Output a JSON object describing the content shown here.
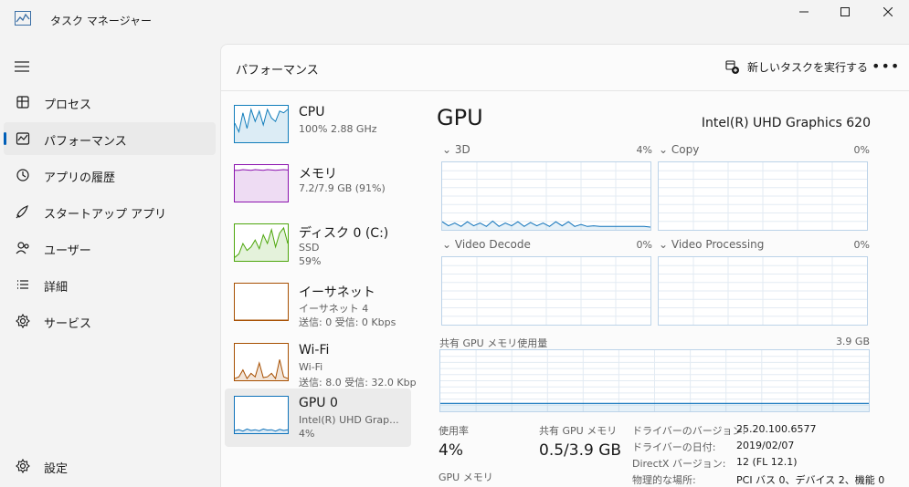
{
  "window": {
    "title": "タスク マネージャー"
  },
  "nav": {
    "items": [
      {
        "label": "プロセス",
        "icon": "processes-icon"
      },
      {
        "label": "パフォーマンス",
        "icon": "performance-icon"
      },
      {
        "label": "アプリの履歴",
        "icon": "history-icon"
      },
      {
        "label": "スタートアップ アプリ",
        "icon": "startup-icon"
      },
      {
        "label": "ユーザー",
        "icon": "users-icon"
      },
      {
        "label": "詳細",
        "icon": "details-icon"
      },
      {
        "label": "サービス",
        "icon": "services-icon"
      }
    ],
    "settings_label": "設定",
    "active_index": 1
  },
  "header": {
    "title": "パフォーマンス",
    "run_task_label": "新しいタスクを実行する",
    "more_label": "•••"
  },
  "devices": [
    {
      "name": "CPU",
      "sub1": "100%  2.88 GHz",
      "sub2": "",
      "color": "#117dbb"
    },
    {
      "name": "メモリ",
      "sub1": "7.2/7.9 GB (91%)",
      "sub2": "",
      "color": "#8b12ae"
    },
    {
      "name": "ディスク 0 (C:)",
      "sub1": "SSD",
      "sub2": "59%",
      "color": "#4da60c"
    },
    {
      "name": "イーサネット",
      "sub1": "イーサネット 4",
      "sub2": "送信: 0 受信: 0 Kbps",
      "color": "#a74f01"
    },
    {
      "name": "Wi-Fi",
      "sub1": "Wi-Fi",
      "sub2": "送信: 8.0 受信: 32.0 Kbp",
      "color": "#a74f01"
    },
    {
      "name": "GPU 0",
      "sub1": "Intel(R) UHD Grap...",
      "sub2": "4%",
      "color": "#0e72ba"
    }
  ],
  "gpu": {
    "title": "GPU",
    "model": "Intel(R) UHD Graphics 620",
    "engines": [
      {
        "label": "3D",
        "pct": "4%"
      },
      {
        "label": "Copy",
        "pct": "0%"
      },
      {
        "label": "Video Decode",
        "pct": "0%"
      },
      {
        "label": "Video Processing",
        "pct": "0%"
      }
    ],
    "shared_memory_label": "共有 GPU メモリ使用量",
    "shared_memory_max": "3.9 GB",
    "stats": {
      "usage_label": "使用率",
      "usage_value": "4%",
      "shared_label": "共有 GPU メモリ",
      "shared_value": "0.5/3.9 GB",
      "gpu_memory_label": "GPU メモリ"
    },
    "details": [
      {
        "key": "ドライバーのバージョン:",
        "value": "25.20.100.6577"
      },
      {
        "key": "ドライバーの日付:",
        "value": "2019/02/07"
      },
      {
        "key": "DirectX バージョン:",
        "value": "12 (FL 12.1)"
      },
      {
        "key": "物理的な場所:",
        "value": "PCI バス 0、デバイス 2、機能 0"
      }
    ]
  },
  "colors": {
    "accent": "#005fb8",
    "gpu_line": "#0e72ba",
    "graph_border": "#bcd3e9"
  }
}
